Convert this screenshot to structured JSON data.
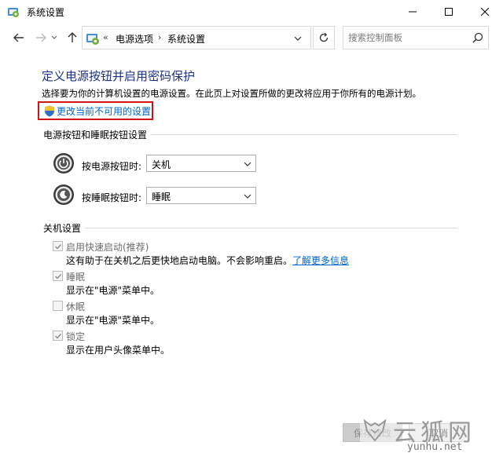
{
  "window": {
    "title": "系统设置"
  },
  "nav": {
    "crumb_more": "«",
    "breadcrumbs": [
      "电源选项",
      "系统设置"
    ],
    "crumb_sep": "›",
    "search_placeholder": "搜索控制面板"
  },
  "page": {
    "title": "定义电源按钮并启用密码保护",
    "description": "选择要为你的计算机设置的电源设置。在此页上对设置所做的更改将应用于你所有的电源计划。",
    "change_link": "更改当前不可用的设置"
  },
  "power_section": {
    "heading": "电源按钮和睡眠按钮设置",
    "power_button": {
      "label": "按电源按钮时:",
      "value": "关机"
    },
    "sleep_button": {
      "label": "按睡眠按钮时:",
      "value": "睡眠"
    }
  },
  "shutdown_section": {
    "heading": "关机设置",
    "items": [
      {
        "label": "启用快速启动(推荐)",
        "checked": true,
        "desc": "这有助于在关机之后更快地启动电脑。不会影响重启。",
        "link": "了解更多信息"
      },
      {
        "label": "睡眠",
        "checked": true,
        "desc": "显示在\"电源\"菜单中。"
      },
      {
        "label": "休眠",
        "checked": false,
        "desc": "显示在\"电源\"菜单中。"
      },
      {
        "label": "锁定",
        "checked": true,
        "desc": "显示在用户头像菜单中。"
      }
    ]
  },
  "buttons": {
    "save": "保存修改",
    "cancel": "取消"
  },
  "watermark": {
    "name": "云狐网",
    "url": "yunhu.net"
  },
  "colors": {
    "title_blue": "#1e3287",
    "link_blue": "#0066cc",
    "highlight_red": "#d21414"
  }
}
